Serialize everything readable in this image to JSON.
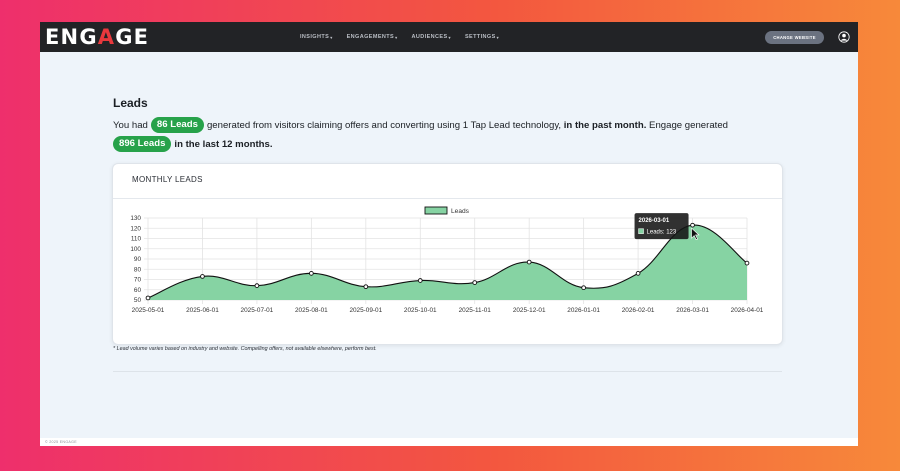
{
  "nav": {
    "logo_prefix": "ENG",
    "logo_accent": "A",
    "logo_suffix": "GE",
    "links": [
      {
        "label": "INSIGHTS",
        "caret": "▾"
      },
      {
        "label": "ENGAGEMENTS",
        "caret": "▾"
      },
      {
        "label": "AUDIENCES",
        "caret": "▾"
      },
      {
        "label": "SETTINGS",
        "caret": "▾"
      }
    ],
    "change_website": "CHANGE WEBSITE",
    "avatar_icon": "user-avatar-icon"
  },
  "page": {
    "heading": "Leads",
    "p1_pre": "You had",
    "leads_month": "86 Leads",
    "p1_mid": "generated from visitors claiming offers and converting using 1 Tap Lead technology,",
    "p1_bold": "in the past month.",
    "p1_post": "Engage generated",
    "leads_year": "896 Leads",
    "p2_bold": "in the last 12 months."
  },
  "card": {
    "title": "MONTHLY LEADS"
  },
  "footnote": "* Lead volume varies based on industry and website. Compelling offers, not available elsewhere, perform best.",
  "copyright": "© 2025 ENGAGE",
  "colors": {
    "brand_accent": "#e8383d",
    "pill_green": "#27a24a",
    "area_fill": "#86d3a3",
    "navbar": "#222326"
  },
  "chart_data": {
    "type": "area",
    "x": [
      "2025-05-01",
      "2025-06-01",
      "2025-07-01",
      "2025-08-01",
      "2025-09-01",
      "2025-10-01",
      "2025-11-01",
      "2025-12-01",
      "2026-01-01",
      "2026-02-01",
      "2026-03-01",
      "2026-04-01"
    ],
    "series": [
      {
        "name": "Leads",
        "values": [
          52,
          73,
          64,
          76,
          63,
          69,
          67,
          87,
          62,
          76,
          123,
          86
        ]
      }
    ],
    "yticks": [
      50,
      60,
      70,
      80,
      90,
      100,
      110,
      120,
      130
    ],
    "ylim": [
      50,
      130
    ],
    "grid": true,
    "legend": "top-center",
    "tooltip": {
      "title": "2026-03-01",
      "label": "Leads: 123",
      "index": 10
    }
  }
}
